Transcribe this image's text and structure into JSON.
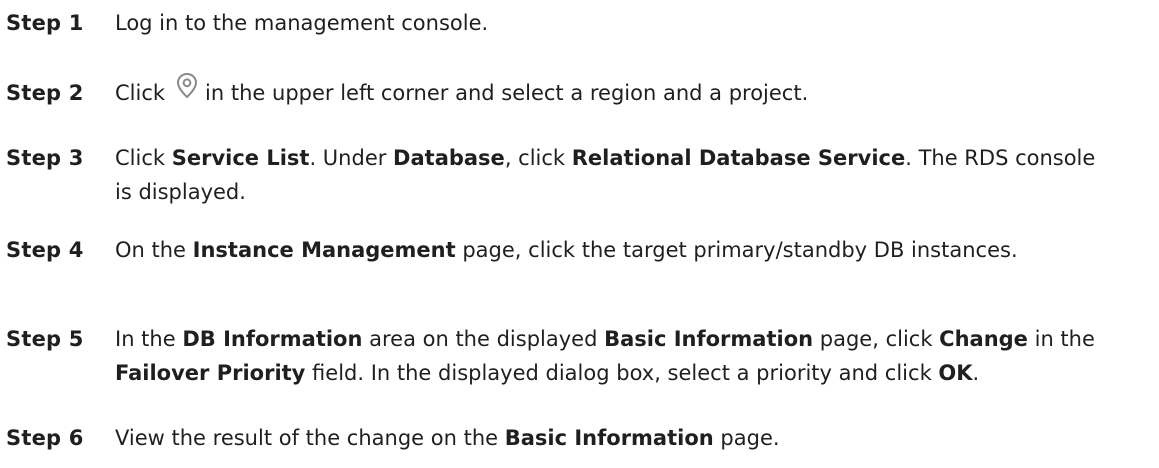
{
  "steps": [
    {
      "label": "Step 1",
      "parts": [
        "Log in to the management console."
      ]
    },
    {
      "label": "Step 2",
      "parts": [
        "Click",
        "in the upper left corner and select a region and a project."
      ],
      "icon": "location-pin-icon"
    },
    {
      "label": "Step 3",
      "parts": [
        "Click ",
        "Service List",
        ". Under ",
        "Database",
        ", click ",
        "Relational Database Service",
        ". The RDS console is displayed."
      ]
    },
    {
      "label": "Step 4",
      "parts": [
        "On the ",
        "Instance Management",
        " page, click the target primary/standby DB instances."
      ]
    },
    {
      "label": "Step 5",
      "parts": [
        "In the ",
        "DB Information",
        " area on the displayed ",
        "Basic Information",
        " page, click ",
        "Change",
        " in the ",
        "Failover Priority",
        " field. In the displayed dialog box, select a priority and click ",
        "OK",
        "."
      ]
    },
    {
      "label": "Step 6",
      "parts": [
        "View the result of the change on the ",
        "Basic Information",
        " page."
      ]
    }
  ],
  "colors": {
    "text": "#1f1f1f",
    "icon": "#8a8a8a"
  }
}
